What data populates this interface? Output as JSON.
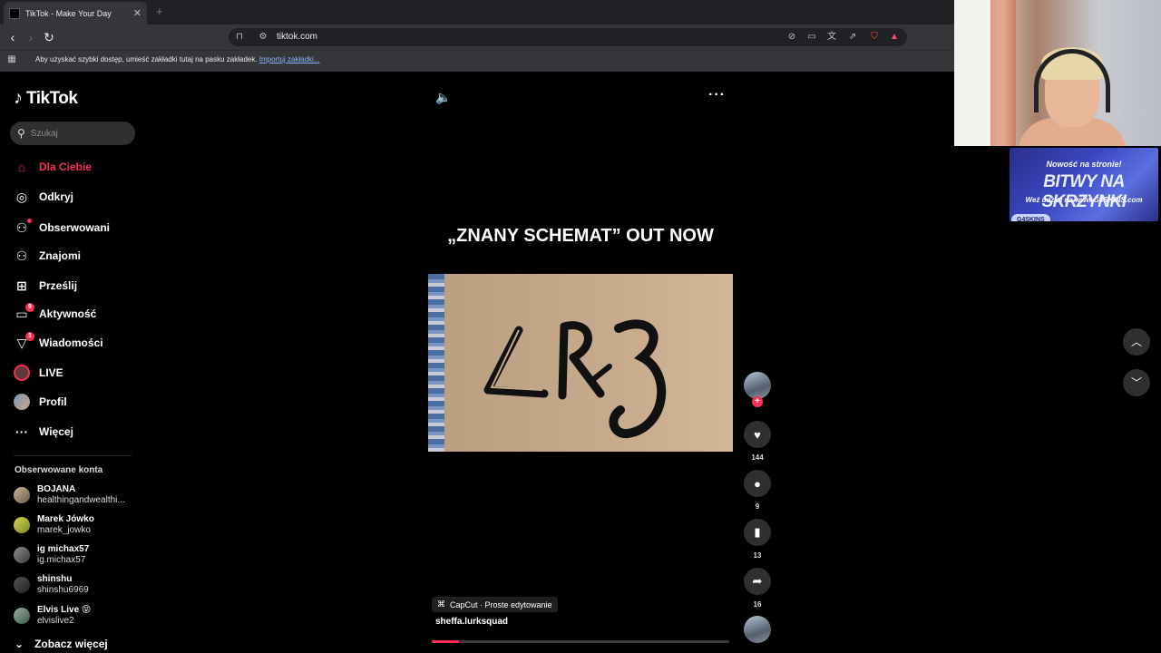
{
  "browser": {
    "tab_title": "TikTok - Make Your Day",
    "tab_close": "✕",
    "new_tab": "+",
    "url": "tiktok.com",
    "bookmark_bar_text": "Aby uzyskać szybki dostęp, umieść zakładki tutaj na pasku zakładek.",
    "bookmark_bar_link": "Importuj zakładki..."
  },
  "sidebar": {
    "logo_text": "TikTok",
    "search_placeholder": "Szukaj",
    "nav": [
      {
        "label": "Dla Ciebie",
        "icon": "home-icon",
        "active": true
      },
      {
        "label": "Odkryj",
        "icon": "compass-icon"
      },
      {
        "label": "Obserwowani",
        "icon": "following-icon"
      },
      {
        "label": "Znajomi",
        "icon": "friends-icon"
      },
      {
        "label": "Prześlij",
        "icon": "upload-icon"
      },
      {
        "label": "Aktywność",
        "icon": "inbox-icon",
        "badge": "9"
      },
      {
        "label": "Wiadomości",
        "icon": "send-icon",
        "badge": "1"
      },
      {
        "label": "LIVE",
        "icon": "live-icon"
      },
      {
        "label": "Profil",
        "icon": "profile-icon"
      },
      {
        "label": "Więcej",
        "icon": "more-icon"
      }
    ],
    "followed_heading": "Obserwowane konta",
    "accounts": [
      {
        "name": "BOJANA",
        "username": "healthingandwealthi..."
      },
      {
        "name": "Marek Jówko",
        "username": "marek_jowko"
      },
      {
        "name": "ig michax57",
        "username": "ig.michax57"
      },
      {
        "name": "shinshu",
        "username": "shinshu6969"
      },
      {
        "name": "Elvis Live 😝",
        "username": "elvislive2"
      }
    ],
    "see_more": "Zobacz więcej"
  },
  "video": {
    "caption": "„ZNANY SCHEMAT” OUT NOW",
    "capcut_label": "CapCut · Proste edytowanie",
    "author": "sheffa.lurksquad",
    "progress": 0.09
  },
  "actions": {
    "likes": "144",
    "comments": "9",
    "saves": "13",
    "shares": "16"
  },
  "overlay": {
    "promo_line1": "Nowość na stronie!",
    "promo_line2": "BITWY NA SKRZYNKI",
    "promo_line3": "Weź udział na www.G4SKINS.com",
    "promo_logo": "G4SKINS"
  },
  "colors": {
    "accent": "#fe2c55",
    "background": "#000000"
  }
}
